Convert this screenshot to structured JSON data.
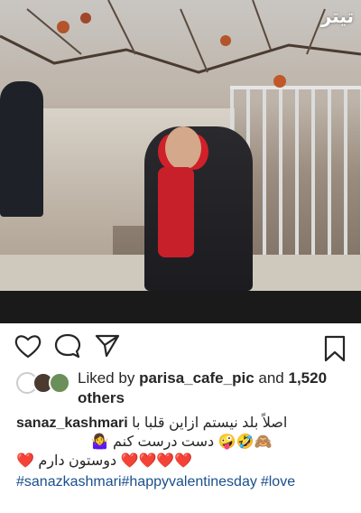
{
  "post": {
    "watermark": "تیتر",
    "likes": {
      "prefix": "Liked by",
      "user": "parisa_cafe_pic",
      "middle": "and",
      "count": "1,520",
      "suffix": "others"
    },
    "caption": {
      "username": "sanaz_kashmari",
      "line1": "اصلاً بلد نیستم ازاین قلبا با",
      "line2": "🙈🤣🤪 دست درست کنم 🤷‍♀️",
      "line3": "❤️❤️❤️❤️ دوستون دارم ❤️",
      "hashtags": [
        "#sanazkashmari",
        "#happyvalentinesday",
        "#love"
      ]
    }
  },
  "icons": {
    "like": "heart-icon",
    "comment": "comment-icon",
    "share": "send-icon",
    "save": "bookmark-icon"
  }
}
